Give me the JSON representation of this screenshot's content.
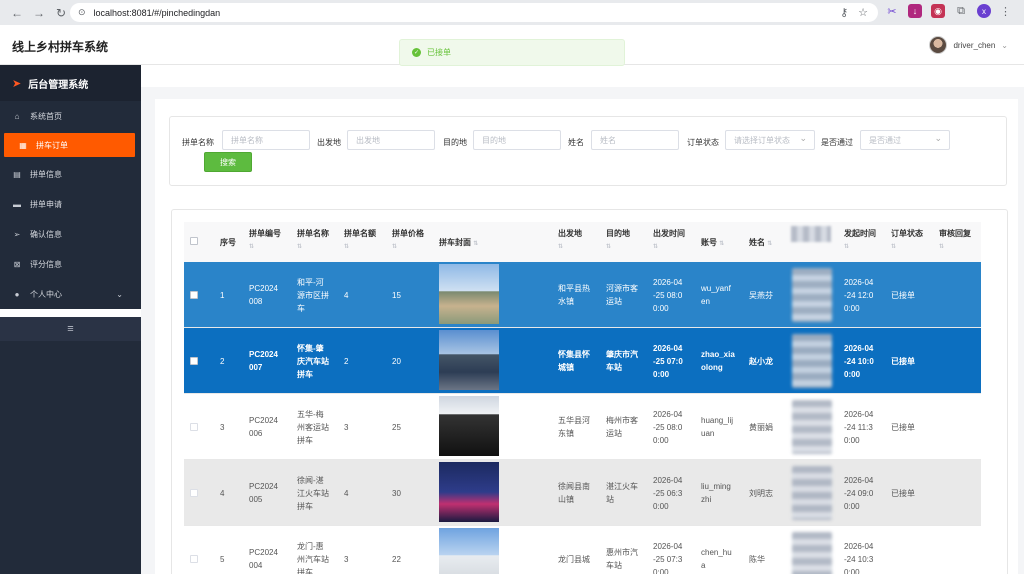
{
  "browser": {
    "url": "localhost:8081/#/pinchedingdan",
    "profile_initial": "x"
  },
  "app": {
    "title": "线上乡村拼车系统",
    "user": "driver_chen"
  },
  "toast": {
    "message": "已接单"
  },
  "sidebar": {
    "title": "后台管理系统",
    "items": [
      {
        "label": "系统首页",
        "icon": "home-icon"
      },
      {
        "label": "拼车订单",
        "icon": "grid-icon",
        "active": true
      },
      {
        "label": "拼单信息",
        "icon": "document-icon"
      },
      {
        "label": "拼单申请",
        "icon": "monitor-icon"
      },
      {
        "label": "确认信息",
        "icon": "send-icon"
      },
      {
        "label": "评分信息",
        "icon": "rating-icon"
      },
      {
        "label": "个人中心",
        "icon": "user-icon"
      }
    ]
  },
  "search": {
    "fields": [
      {
        "label": "拼单名称",
        "placeholder": "拼单名称"
      },
      {
        "label": "出发地",
        "placeholder": "出发地"
      },
      {
        "label": "目的地",
        "placeholder": "目的地"
      },
      {
        "label": "姓名",
        "placeholder": "姓名"
      },
      {
        "label": "订单状态",
        "placeholder": "请选择订单状态"
      },
      {
        "label": "是否通过",
        "placeholder": "是否通过"
      }
    ],
    "button": "搜索"
  },
  "table": {
    "headers": [
      "序号",
      "拼单编号",
      "拼单名称",
      "拼单名额",
      "拼单价格",
      "拼车封面",
      "出发地",
      "目的地",
      "出发时间",
      "账号",
      "姓名",
      "发起时间",
      "订单状态",
      "审核回复"
    ],
    "rows": [
      {
        "idx": "1",
        "code": [
          "PC2024",
          "008"
        ],
        "name": [
          "和平-河",
          "源市区拼",
          "车"
        ],
        "seats": "4",
        "price": "15",
        "from": [
          "和平县热",
          "水镇"
        ],
        "to": [
          "河源市客",
          "运站"
        ],
        "depart": [
          "2026-04",
          "-25 08:0",
          "0:00"
        ],
        "account": [
          "wu_yanf",
          "en"
        ],
        "person": "吴燕芬",
        "created": [
          "2026-04",
          "-24 12:0",
          "0:00"
        ],
        "status": "已接单",
        "reply": ""
      },
      {
        "idx": "2",
        "code": [
          "PC2024",
          "007"
        ],
        "name": [
          "怀集-肇",
          "庆汽车站",
          "拼车"
        ],
        "seats": "2",
        "price": "20",
        "from": [
          "怀集县怀",
          "城镇"
        ],
        "to": [
          "肇庆市汽",
          "车站"
        ],
        "depart": [
          "2026-04",
          "-25 07:0",
          "0:00"
        ],
        "account": [
          "zhao_xia",
          "olong"
        ],
        "person": "赵小龙",
        "created": [
          "2026-04",
          "-24 10:0",
          "0:00"
        ],
        "status": "已接单",
        "reply": ""
      },
      {
        "idx": "3",
        "code": [
          "PC2024",
          "006"
        ],
        "name": [
          "五华-梅",
          "州客运站",
          "拼车"
        ],
        "seats": "3",
        "price": "25",
        "from": [
          "五华县河",
          "东镇"
        ],
        "to": [
          "梅州市客",
          "运站"
        ],
        "depart": [
          "2026-04",
          "-25 08:0",
          "0:00"
        ],
        "account": [
          "huang_lij",
          "uan"
        ],
        "person": "黄丽娟",
        "created": [
          "2026-04",
          "-24 11:3",
          "0:00"
        ],
        "status": "已接单",
        "reply": ""
      },
      {
        "idx": "4",
        "code": [
          "PC2024",
          "005"
        ],
        "name": [
          "徐闻-湛",
          "江火车站",
          "拼车"
        ],
        "seats": "4",
        "price": "30",
        "from": [
          "徐闻县南",
          "山镇"
        ],
        "to": [
          "湛江火车",
          "站"
        ],
        "depart": [
          "2026-04",
          "-25 06:3",
          "0:00"
        ],
        "account": [
          "liu_ming",
          "zhi"
        ],
        "person": "刘明志",
        "created": [
          "2026-04",
          "-24 09:0",
          "0:00"
        ],
        "status": "已接单",
        "reply": ""
      },
      {
        "idx": "5",
        "code": [
          "PC2024",
          "004"
        ],
        "name": [
          "龙门-惠",
          "州汽车站",
          "拼车"
        ],
        "seats": "3",
        "price": "22",
        "from": [
          "龙门县城",
          ""
        ],
        "to": [
          "惠州市汽",
          "车站"
        ],
        "depart": [
          "2026-04",
          "-25 07:3",
          "0:00"
        ],
        "account": [
          "chen_hu",
          "a"
        ],
        "person": "陈华",
        "created": [
          "2026-04",
          "-24 10:3",
          "0:00"
        ],
        "status": "",
        "reply": ""
      }
    ]
  }
}
